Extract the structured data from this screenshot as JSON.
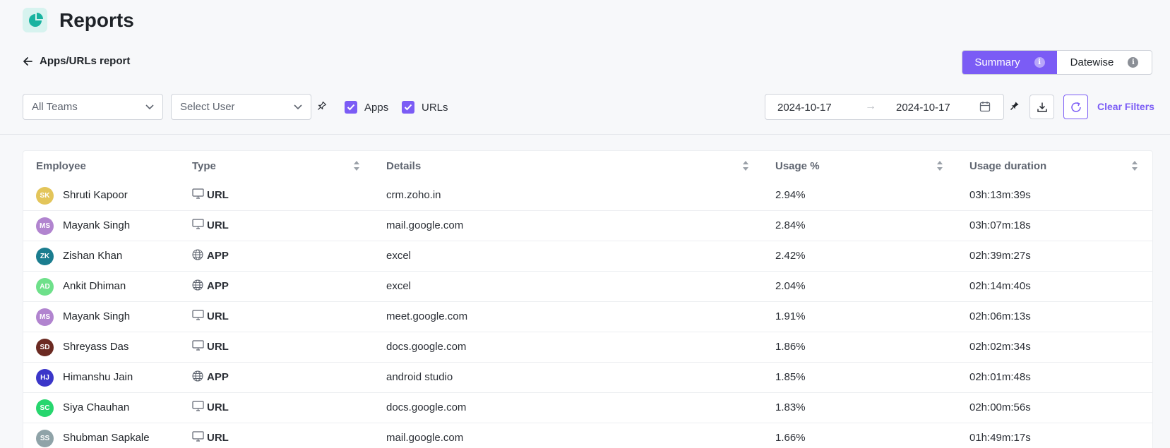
{
  "header": {
    "title": "Reports"
  },
  "nav": {
    "back_label": "Apps/URLs report"
  },
  "view_toggle": {
    "summary_label": "Summary",
    "datewise_label": "Datewise",
    "selected": "Summary"
  },
  "filters": {
    "teams_value": "All Teams",
    "user_placeholder": "Select User",
    "apps_label": "Apps",
    "apps_checked": true,
    "urls_label": "URLs",
    "urls_checked": true,
    "date_from": "2024-10-17",
    "date_to": "2024-10-17",
    "clear_label": "Clear Filters"
  },
  "colors": {
    "accent": "#7b5cf5",
    "logo_bg": "#d7f3ef",
    "logo_fg": "#19b3a0"
  },
  "table": {
    "columns": [
      "Employee",
      "Type",
      "Details",
      "Usage %",
      "Usage duration"
    ],
    "rows": [
      {
        "initials": "SK",
        "color": "#e3c55a",
        "name": "Shruti Kapoor",
        "type_icon": "monitor-icon",
        "type": "URL",
        "details": "crm.zoho.in",
        "usage": "2.94%",
        "duration": "03h:13m:39s"
      },
      {
        "initials": "MS",
        "color": "#b184cf",
        "name": "Mayank Singh",
        "type_icon": "monitor-icon",
        "type": "URL",
        "details": "mail.google.com",
        "usage": "2.84%",
        "duration": "03h:07m:18s"
      },
      {
        "initials": "ZK",
        "color": "#1b7d8f",
        "name": "Zishan Khan",
        "type_icon": "globe-icon",
        "type": "APP",
        "details": "excel",
        "usage": "2.42%",
        "duration": "02h:39m:27s"
      },
      {
        "initials": "AD",
        "color": "#6ee08a",
        "name": "Ankit Dhiman",
        "type_icon": "globe-icon",
        "type": "APP",
        "details": "excel",
        "usage": "2.04%",
        "duration": "02h:14m:40s"
      },
      {
        "initials": "MS",
        "color": "#b184cf",
        "name": "Mayank Singh",
        "type_icon": "monitor-icon",
        "type": "URL",
        "details": "meet.google.com",
        "usage": "1.91%",
        "duration": "02h:06m:13s"
      },
      {
        "initials": "SD",
        "color": "#6b2a22",
        "name": "Shreyass Das",
        "type_icon": "monitor-icon",
        "type": "URL",
        "details": "docs.google.com",
        "usage": "1.86%",
        "duration": "02h:02m:34s"
      },
      {
        "initials": "HJ",
        "color": "#3b36c9",
        "name": "Himanshu Jain",
        "type_icon": "globe-icon",
        "type": "APP",
        "details": "android studio",
        "usage": "1.85%",
        "duration": "02h:01m:48s"
      },
      {
        "initials": "SC",
        "color": "#27d66e",
        "name": "Siya Chauhan",
        "type_icon": "monitor-icon",
        "type": "URL",
        "details": "docs.google.com",
        "usage": "1.83%",
        "duration": "02h:00m:56s"
      },
      {
        "initials": "SS",
        "color": "#8fa3a8",
        "name": "Shubman Sapkale",
        "type_icon": "monitor-icon",
        "type": "URL",
        "details": "mail.google.com",
        "usage": "1.66%",
        "duration": "01h:49m:17s"
      }
    ]
  }
}
